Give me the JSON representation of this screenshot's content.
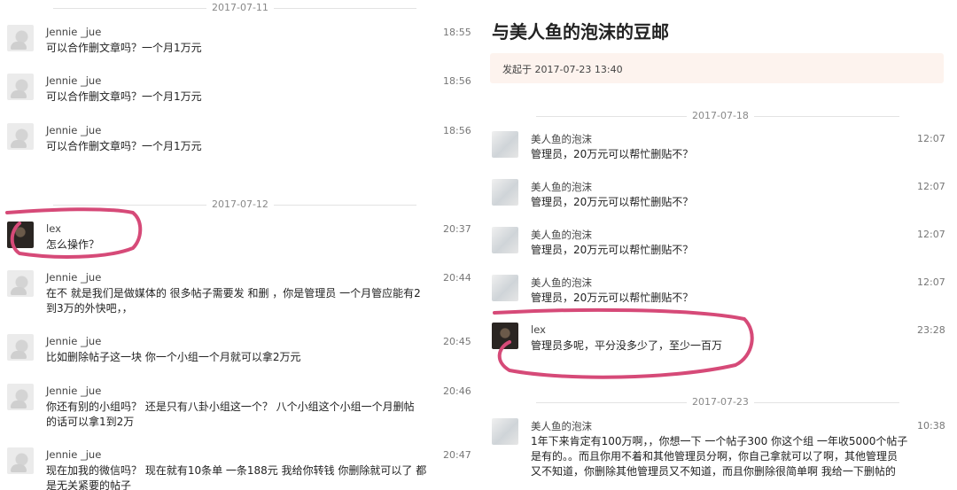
{
  "left": {
    "dates": [
      "2017-07-11",
      "2017-07-12"
    ],
    "messages": [
      {
        "name": "Jennie _jue",
        "time": "18:55",
        "text": "可以合作删文章吗？一个月1万元"
      },
      {
        "name": "Jennie _jue",
        "time": "18:56",
        "text": "可以合作删文章吗？一个月1万元"
      },
      {
        "name": "Jennie _jue",
        "time": "18:56",
        "text": "可以合作删文章吗？一个月1万元"
      },
      {
        "name": "lex",
        "time": "20:37",
        "text": "怎么操作？"
      },
      {
        "name": "Jennie _jue",
        "time": "20:44",
        "text": "在不 就是我们是做媒体的 很多帖子需要发 和删 ，你是管理员 一个月管应能有2\n到3万的外快吧，，"
      },
      {
        "name": "Jennie _jue",
        "time": "20:45",
        "text": "比如删除帖子这一块 你一个小组一个月就可以拿2万元"
      },
      {
        "name": "Jennie _jue",
        "time": "20:46",
        "text": "你还有别的小组吗？ 还是只有八卦小组这一个？ 八个小组这个小组一个月删帖\n的话可以拿1到2万"
      },
      {
        "name": "Jennie _jue",
        "time": "20:47",
        "text": "现在加我的微信吗？ 现在就有10条单 一条188元 我给你转钱 你删除就可以了 都\n是无关紧要的帖子"
      }
    ]
  },
  "right": {
    "title": "与美人鱼的泡沫的豆邮",
    "started": "发起于 2017-07-23 13:40",
    "dates": [
      "2017-07-18",
      "2017-07-23"
    ],
    "messages": [
      {
        "name": "美人鱼的泡沫",
        "time": "12:07",
        "text": "管理员，20万元可以帮忙删贴不？"
      },
      {
        "name": "美人鱼的泡沫",
        "time": "12:07",
        "text": "管理员，20万元可以帮忙删贴不？"
      },
      {
        "name": "美人鱼的泡沫",
        "time": "12:07",
        "text": "管理员，20万元可以帮忙删贴不？"
      },
      {
        "name": "美人鱼的泡沫",
        "time": "12:07",
        "text": "管理员，20万元可以帮忙删贴不？"
      },
      {
        "name": "lex",
        "time": "23:28",
        "text": "管理员多呢，平分没多少了，至少一百万"
      },
      {
        "name": "美人鱼的泡沫",
        "time": "10:38",
        "text": "1年下来肯定有100万啊，，你想一下 一个帖子300 你这个组 一年收5000个帖子\n是有的。。而且你用不着和其他管理员分啊，你自己拿就可以了啊，其他管理员\n又不知道，你删除其他管理员又不知道，而且你删除很简单啊 我给一下删帖的"
      }
    ]
  },
  "colors": {
    "highlight": "#d64a78"
  }
}
